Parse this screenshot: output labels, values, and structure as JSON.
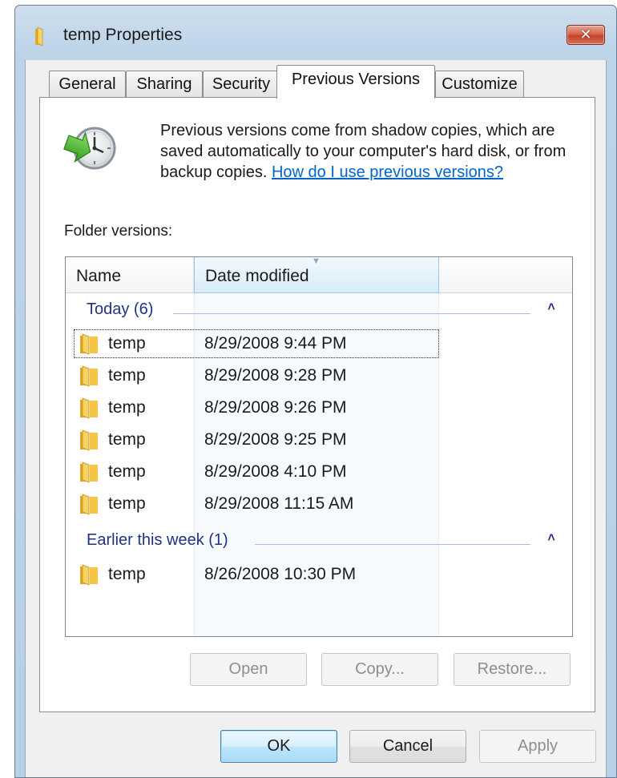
{
  "window": {
    "title": "temp Properties",
    "close_label": "✕"
  },
  "tabs": [
    {
      "label": "General"
    },
    {
      "label": "Sharing"
    },
    {
      "label": "Security"
    },
    {
      "label": "Previous Versions",
      "active": true
    },
    {
      "label": "Customize"
    }
  ],
  "info": {
    "text": "Previous versions come from shadow copies, which are saved automatically to your computer's hard disk, or from backup copies.",
    "link": "How do I use previous versions?"
  },
  "folder_versions_label": "Folder versions:",
  "list": {
    "columns": [
      "Name",
      "Date modified"
    ],
    "groups": [
      {
        "label": "Today (6)",
        "items": [
          {
            "name": "temp",
            "date": "8/29/2008 9:44 PM"
          },
          {
            "name": "temp",
            "date": "8/29/2008 9:28 PM"
          },
          {
            "name": "temp",
            "date": "8/29/2008 9:26 PM"
          },
          {
            "name": "temp",
            "date": "8/29/2008 9:25 PM"
          },
          {
            "name": "temp",
            "date": "8/29/2008 4:10 PM"
          },
          {
            "name": "temp",
            "date": "8/29/2008 11:15 AM"
          }
        ]
      },
      {
        "label": "Earlier this week (1)",
        "items": [
          {
            "name": "temp",
            "date": "8/26/2008 10:30 PM"
          }
        ]
      }
    ]
  },
  "action_buttons": {
    "open": "Open",
    "copy": "Copy...",
    "restore": "Restore..."
  },
  "dialog_buttons": {
    "ok": "OK",
    "cancel": "Cancel",
    "apply": "Apply"
  },
  "colors": {
    "link": "#0066cc",
    "group_header": "#1e3287",
    "folder_yellow": "#f3c54a"
  }
}
